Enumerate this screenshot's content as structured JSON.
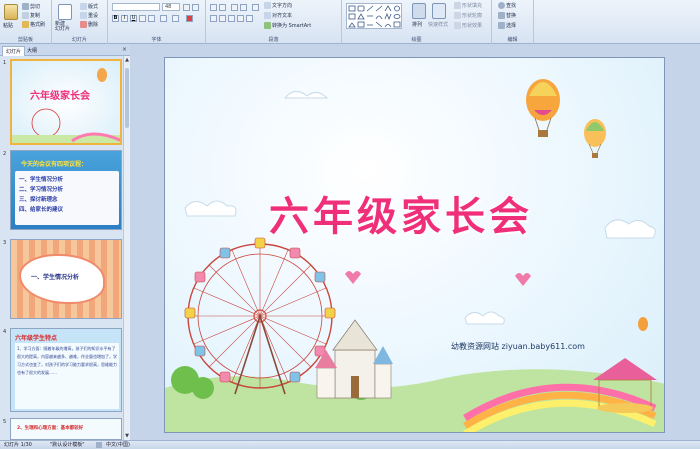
{
  "ribbon": {
    "clipboard": {
      "paste": "粘贴",
      "cut": "剪切",
      "copy": "复制",
      "format_painter": "格式刷",
      "label": "剪贴板"
    },
    "slides": {
      "new_slide": "新建\n幻灯片",
      "layout": "版式",
      "reset": "重设",
      "delete": "删除",
      "label": "幻灯片"
    },
    "font": {
      "font_name": "",
      "font_size": "48",
      "label": "字体"
    },
    "paragraph": {
      "text_direction": "文字方向",
      "align_text": "对齐文本",
      "smartart": "转换为 SmartArt",
      "label": "段落"
    },
    "drawing": {
      "arrange": "排列",
      "quick_styles": "快速样式",
      "shape_fill": "形状填充",
      "shape_outline": "形状轮廓",
      "shape_effects": "形状效果",
      "label": "绘图"
    },
    "editing": {
      "find": "查找",
      "replace": "替换",
      "select": "选择",
      "label": "编辑"
    }
  },
  "panel": {
    "tab_slides": "幻灯片",
    "tab_outline": "大纲",
    "close": "×",
    "thumbs": [
      {
        "num": "1",
        "title": "六年级家长会"
      },
      {
        "num": "2",
        "heading": "今天的会议有四项议程：",
        "items": [
          "一、学生情况分析",
          "二、学习情况分析",
          "三、探讨新理念",
          "四、给家长的建议"
        ]
      },
      {
        "num": "3",
        "title": "一、学生情况分析"
      },
      {
        "num": "4",
        "heading": "六年级学生特点",
        "body": "1、学习方面：随着年级的增高，孩子们的知识水平有了很大的提高，内容越来越多、越难，作业量也增加了，学习方式也变了，对孩子们的学习能力要求很高，思维能力也有了很大的发展……"
      },
      {
        "num": "5",
        "body": "2、生理和心理方面：基本都较好"
      }
    ]
  },
  "slide": {
    "title": "六年级家长会",
    "watermark": "幼教资源网站  ziyuan.baby611.com"
  },
  "status": {
    "slide_info": "幻灯片 1/30",
    "theme": "\"默认设计模板\"",
    "language": "中文(中国)"
  },
  "colors": {
    "title_pink": "#ef2f7a",
    "ribbon_bg": "#dbe6f4",
    "pane_bg": "#d9e4f2"
  }
}
